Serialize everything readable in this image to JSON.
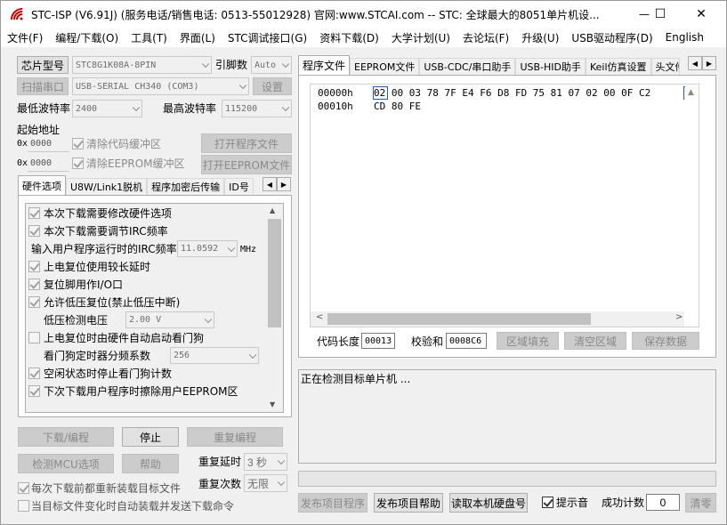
{
  "window": {
    "title": "STC-ISP (V6.91J) (服务电话/销售电话: 0513-55012928) 官网:www.STCAI.com  -- STC: 全球最大的8051单片机设...",
    "minimize": "—",
    "maximize": "☐",
    "close": "✕"
  },
  "menu": [
    "文件(F)",
    "编程/下载(O)",
    "工具(T)",
    "界面(L)",
    "STC调试接口(G)",
    "资料下载(D)",
    "大学计划(U)",
    "去论坛(F)",
    "升级(U)",
    "USB驱动程序(D)",
    "English"
  ],
  "left": {
    "chip_label": "芯片型号",
    "chip_value": "STC8G1K08A-8PIN",
    "pin_label": "引脚数",
    "pin_value": "Auto",
    "scan_label": "扫描串口",
    "port_value": "USB-SERIAL CH340 (COM3)",
    "settings_label": "设置",
    "min_baud_label": "最低波特率",
    "min_baud_value": "2400",
    "max_baud_label": "最高波特率",
    "max_baud_value": "115200",
    "start_addr_label": "起始地址",
    "addr1_prefix": "0x",
    "addr1_value": "0000",
    "clear_code_label": "清除代码缓冲区",
    "open_prog_label": "打开程序文件",
    "addr2_prefix": "0x",
    "addr2_value": "0000",
    "clear_eeprom_label": "清除EEPROM缓冲区",
    "open_eeprom_label": "打开EEPROM文件",
    "tabs": [
      "硬件选项",
      "U8W/Link1脱机",
      "程序加密后传输",
      "ID号"
    ],
    "options": [
      {
        "label": "本次下载需要修改硬件选项",
        "checked": true,
        "disabled": true
      },
      {
        "label": "本次下载需要调节IRC频率",
        "checked": true,
        "disabled": true
      }
    ],
    "irc_label": "输入用户程序运行时的IRC频率",
    "irc_value": "11.0592",
    "irc_unit": "MHz",
    "options2": [
      {
        "label": "上电复位使用较长延时",
        "checked": true
      },
      {
        "label": "复位脚用作I/O口",
        "checked": true
      },
      {
        "label": "允许低压复位(禁止低压中断)",
        "checked": true
      }
    ],
    "lvd_label": "低压检测电压",
    "lvd_value": "2.00 V",
    "wdt_label": "上电复位时由硬件自动启动看门狗",
    "wdt_checked": false,
    "wdt_div_label": "看门狗定时器分频系数",
    "wdt_div_value": "256",
    "options3": [
      {
        "label": "空闲状态时停止看门狗计数",
        "checked": true
      },
      {
        "label": "下次下载用户程序时擦除用户EEPROM区",
        "checked": true
      }
    ],
    "download_label": "下载/编程",
    "stop_label": "停止",
    "reprogram_label": "重复编程",
    "detect_label": "检测MCU选项",
    "help_label": "帮助",
    "delay_label": "重复延时",
    "delay_value": "3 秒",
    "count_label": "重复次数",
    "count_value": "无限",
    "reload_label": "每次下载前都重新装载目标文件",
    "reload_checked": true,
    "autoload_label": "当目标文件变化时自动装载并发送下载命令",
    "autoload_checked": false
  },
  "right": {
    "tabs": [
      "程序文件",
      "EEPROM文件",
      "USB-CDC/串口助手",
      "USB-HID助手",
      "Keil仿真设置",
      "头文件"
    ],
    "hex_rows": [
      {
        "addr": "00000h",
        "bytes": "02 00 03 78 7F E4 F6 D8 FD 75 81 07 02 00 0F C2"
      },
      {
        "addr": "00010h",
        "bytes": "CD 80 FE"
      }
    ],
    "code_len_label": "代码长度",
    "code_len_value": "00013",
    "checksum_label": "校验和",
    "checksum_value": "0008C6",
    "fill_label": "区域填充",
    "clear_label": "清空区域",
    "save_label": "保存数据",
    "log_text": "正在检测目标单片机 ...",
    "publish_label": "发布项目程序",
    "publish_help_label": "发布项目帮助",
    "read_disk_label": "读取本机硬盘号",
    "sound_label": "提示音",
    "sound_checked": true,
    "success_label": "成功计数",
    "success_value": "0",
    "clear_count_label": "清零"
  }
}
